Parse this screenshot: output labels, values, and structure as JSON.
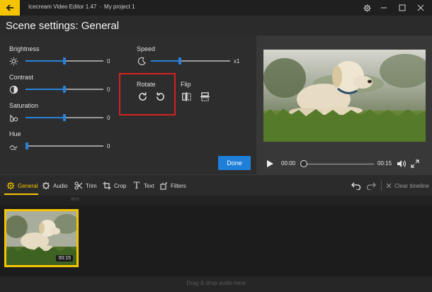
{
  "window": {
    "app_name": "Icecream Video Editor 1.47",
    "separator": "-",
    "project_name": "My project 1"
  },
  "page_title": "Scene settings: General",
  "controls": {
    "brightness": {
      "label": "Brightness",
      "value": "0",
      "level": 0.5
    },
    "contrast": {
      "label": "Contrast",
      "value": "0",
      "level": 0.5
    },
    "saturation": {
      "label": "Saturation",
      "value": "0",
      "level": 0.5
    },
    "hue": {
      "label": "Hue",
      "value": "0",
      "level": 0.0
    },
    "speed": {
      "label": "Speed",
      "value": "x1",
      "level": 0.36
    },
    "rotate": {
      "label": "Rotate"
    },
    "flip": {
      "label": "Flip"
    }
  },
  "done_label": "Done",
  "player": {
    "current_time": "00:00",
    "duration": "00:15",
    "progress": 0.0
  },
  "tabs": [
    {
      "label": "General",
      "icon": "gear-icon",
      "active": true
    },
    {
      "label": "Audio",
      "icon": "audio-gear-icon",
      "active": false
    },
    {
      "label": "Trim",
      "icon": "scissors-icon",
      "active": false
    },
    {
      "label": "Crop",
      "icon": "crop-icon",
      "active": false
    },
    {
      "label": "Text",
      "icon": "text-icon",
      "active": false
    },
    {
      "label": "Filters",
      "icon": "filters-icon",
      "active": false
    }
  ],
  "timeline_actions": {
    "clear_label": "Clear timeline"
  },
  "timeline": {
    "ruler_label": "00:0",
    "clip_duration": "00:15",
    "audio_placeholder": "Drag & drop audio here"
  },
  "colors": {
    "accent": "#f5c400",
    "slider": "#2a82d8",
    "highlight_box": "#d42222",
    "done_button": "#1e7fd8"
  }
}
